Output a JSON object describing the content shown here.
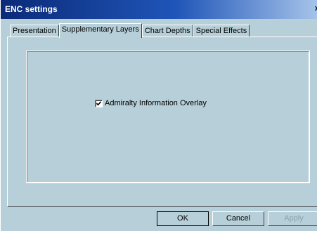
{
  "window": {
    "title": "ENC settings",
    "close_label": "x"
  },
  "tabs": [
    {
      "label": "Presentation"
    },
    {
      "label": "Supplementary Layers"
    },
    {
      "label": "Chart Depths"
    },
    {
      "label": "Special Effects"
    }
  ],
  "active_tab": "Supplementary Layers",
  "panel": {
    "admiralty_overlay": {
      "label": "Admiralty Information Overlay",
      "checked": true
    }
  },
  "buttons": {
    "ok": "OK",
    "cancel": "Cancel",
    "apply": "Apply"
  },
  "colors": {
    "dialog_bg": "#b7cfd8",
    "title_bg": "#0b2a78"
  }
}
